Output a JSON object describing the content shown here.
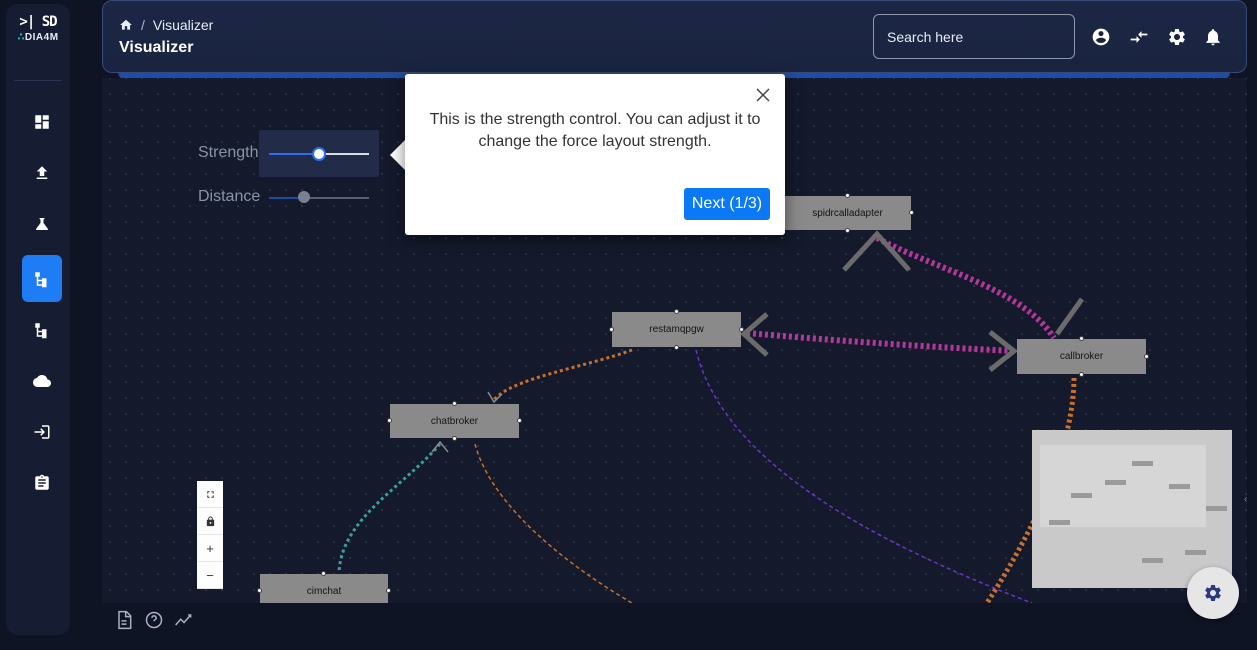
{
  "sidebar": {
    "logo_mark": ">| SD",
    "brand_lead": "∴",
    "brand": "DIA4M",
    "items": [
      {
        "name": "dashboard",
        "icon": "grid-icon"
      },
      {
        "name": "upload",
        "icon": "upload-icon"
      },
      {
        "name": "lab",
        "icon": "flask-icon"
      },
      {
        "name": "visualizer",
        "icon": "tree-icon",
        "active": true
      },
      {
        "name": "hierarchy",
        "icon": "tree-icon"
      },
      {
        "name": "cloud",
        "icon": "cloud-icon"
      },
      {
        "name": "login",
        "icon": "login-icon"
      },
      {
        "name": "clipboard",
        "icon": "clipboard-icon"
      }
    ]
  },
  "header": {
    "breadcrumb_sep": "/",
    "breadcrumb_current": "Visualizer",
    "title": "Visualizer",
    "search_placeholder": "Search here"
  },
  "controls": {
    "strength_label": "Strength",
    "distance_label": "Distance",
    "strength_value": 0.5,
    "distance_value": 0.35
  },
  "graph": {
    "nodes": [
      {
        "id": "spidrcalladapter",
        "label": "spidrcalladapter"
      },
      {
        "id": "restamqpgw",
        "label": "restamqpgw"
      },
      {
        "id": "callbroker",
        "label": "callbroker"
      },
      {
        "id": "chatbroker",
        "label": "chatbroker"
      },
      {
        "id": "cimchat",
        "label": "cimchat"
      }
    ],
    "edge_colors": {
      "magenta": "#b5379a",
      "orange": "#c8702e",
      "teal": "#3aa0a0",
      "purple": "#6a35c8"
    }
  },
  "zoom": {
    "plus": "+",
    "minus": "−"
  },
  "tour": {
    "text": "This is the strength control. You can adjust it to change the force layout strength.",
    "next_label": "Next (1/3)"
  },
  "colors": {
    "accent": "#1e7cf5",
    "popover_button": "#0b78f5",
    "background": "#0f1424"
  }
}
